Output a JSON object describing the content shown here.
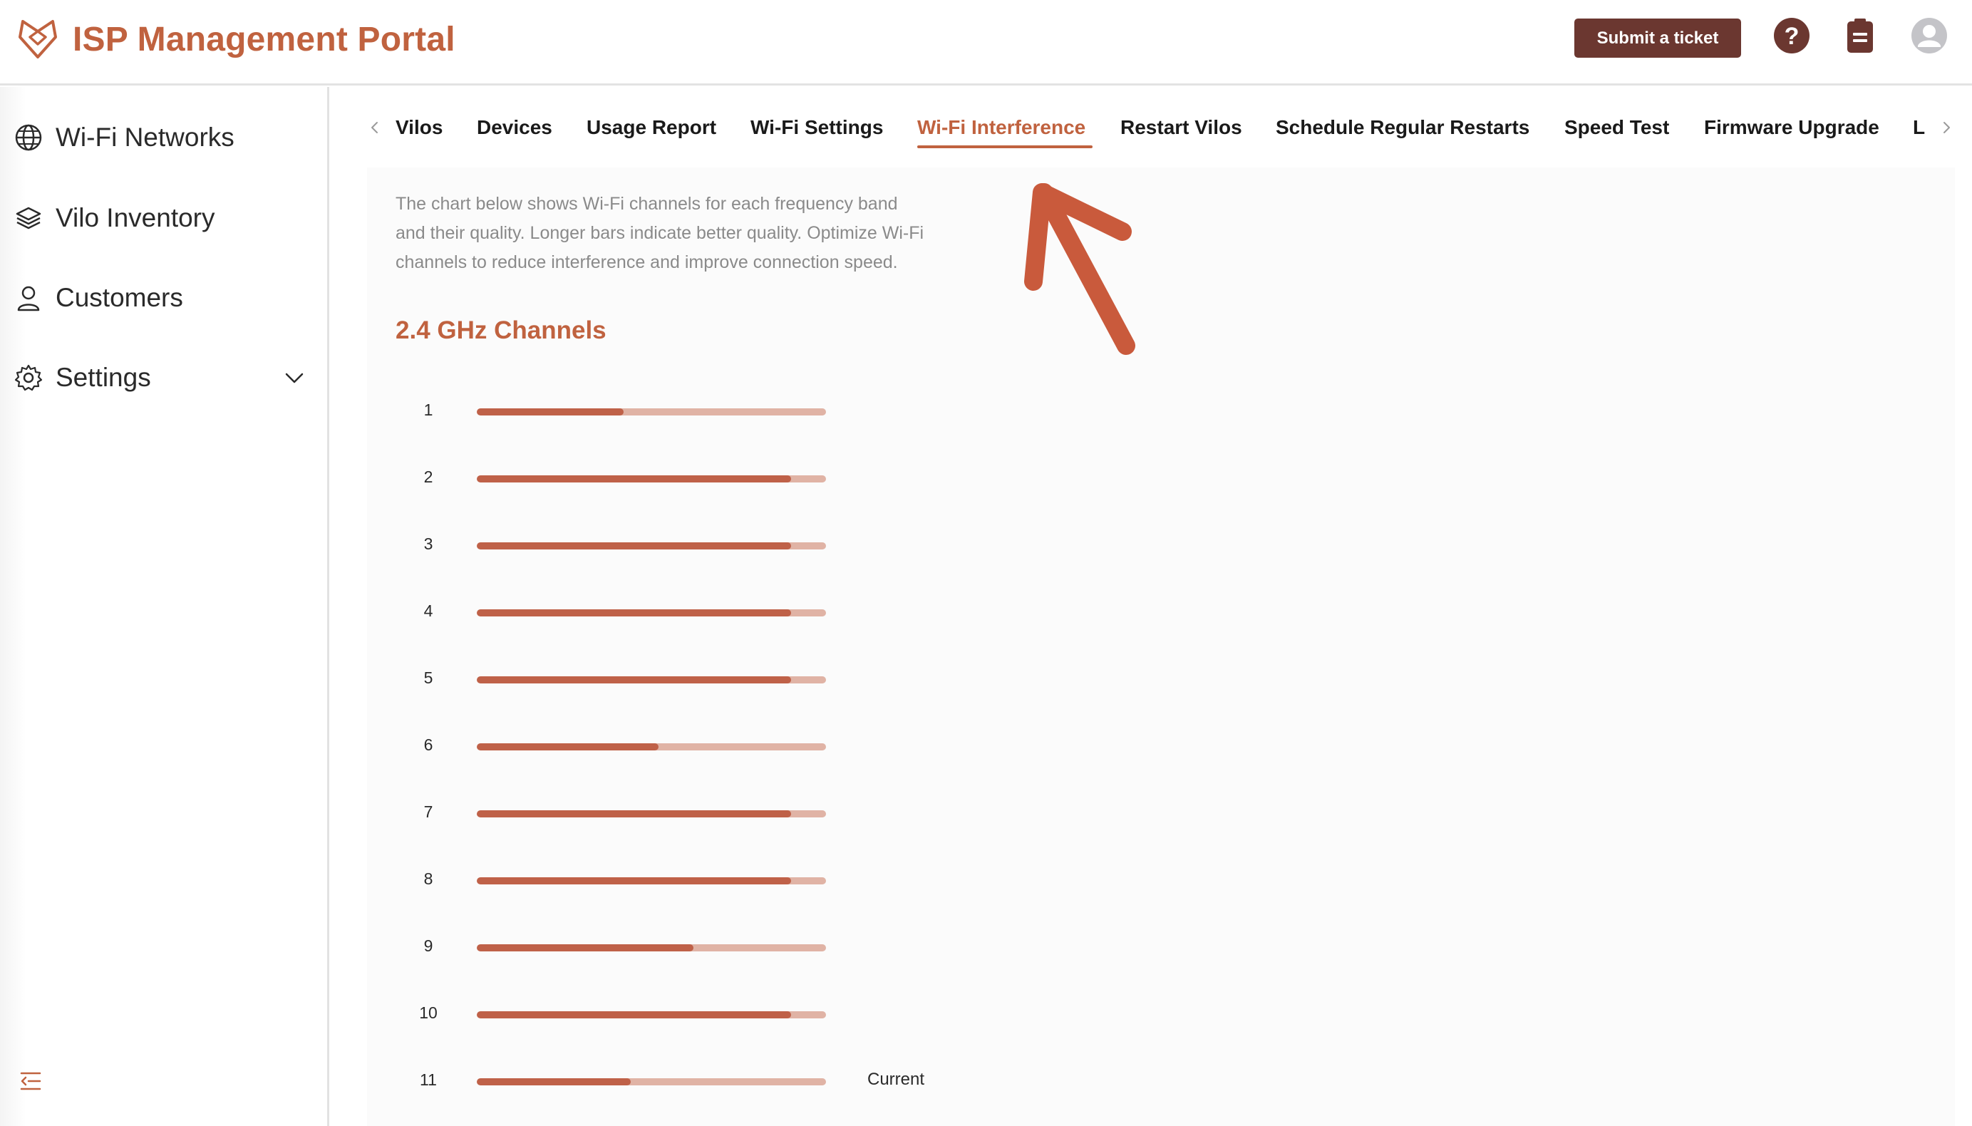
{
  "header": {
    "title": "ISP Management Portal",
    "submit_label": "Submit a ticket",
    "icons": [
      "brand-logo",
      "help-icon",
      "clipboard-icon",
      "account-icon"
    ]
  },
  "sidebar": {
    "items": [
      {
        "label": "Wi-Fi Networks",
        "icon": "globe-icon"
      },
      {
        "label": "Vilo Inventory",
        "icon": "layers-icon"
      },
      {
        "label": "Customers",
        "icon": "person-icon"
      },
      {
        "label": "Settings",
        "icon": "gear-icon"
      }
    ]
  },
  "tabs": {
    "items": [
      "Vilos",
      "Devices",
      "Usage Report",
      "Wi-Fi Settings",
      "Wi-Fi Interference",
      "Restart Vilos",
      "Schedule Regular Restarts",
      "Speed Test",
      "Firmware Upgrade",
      "L"
    ],
    "active": "Wi-Fi Interference"
  },
  "main": {
    "description_lines": [
      "The chart below shows Wi-Fi channels for each frequency band",
      "and their quality. Longer bars indicate better quality. Optimize Wi-Fi",
      "channels to reduce interference and improve connection speed."
    ],
    "section_title": "2.4 GHz Channels",
    "current_label": "Current"
  },
  "colors": {
    "accent": "#c0623f",
    "button": "#6b3730",
    "bar_fill": "#bf6148",
    "bar_track": "#e0b3a5"
  },
  "chart_data": {
    "type": "bar",
    "title": "2.4 GHz Channels",
    "categories": [
      "1",
      "2",
      "3",
      "4",
      "5",
      "6",
      "7",
      "8",
      "9",
      "10",
      "11"
    ],
    "values": [
      0.42,
      0.9,
      0.9,
      0.9,
      0.9,
      0.52,
      0.9,
      0.9,
      0.62,
      0.9,
      0.44
    ],
    "current": "11"
  }
}
